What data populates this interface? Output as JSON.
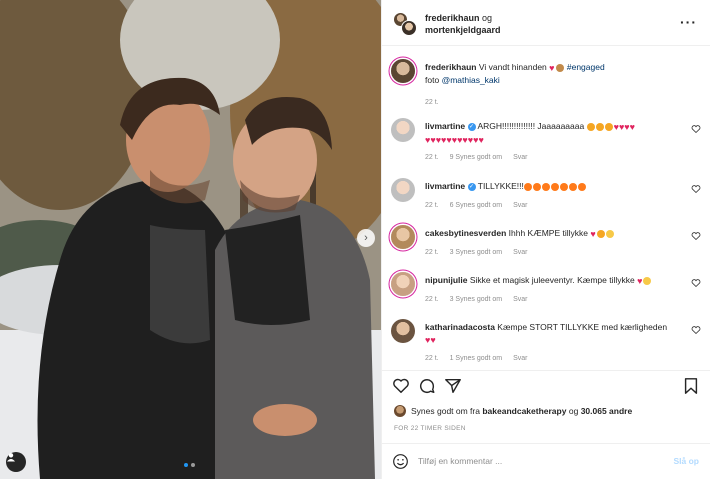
{
  "header": {
    "user1": "frederikhaun",
    "joiner": "og",
    "user2": "mortenkjeldgaard",
    "more_icon": "more-horizontal-icon"
  },
  "caption": {
    "username": "frederikhaun",
    "text": "Vi vandt hinanden",
    "hashtag": "#engaged",
    "photo_prefix": "foto",
    "mention": "@mathias_kaki",
    "time": "22 t."
  },
  "comments": [
    {
      "username": "livmartine",
      "verified": true,
      "text": "ARGH!!!!!!!!!!!!!! Jaaaaaaaaa",
      "time": "22 t.",
      "likes": "9 Synes godt om",
      "reply": "Svar",
      "emojis": [
        "fire-face",
        "fire-face",
        "fire-face",
        "heart",
        "heart",
        "heart",
        "heart",
        "heart",
        "heart",
        "heart",
        "heart",
        "heart",
        "heart",
        "heart",
        "heart"
      ]
    },
    {
      "username": "livmartine",
      "verified": true,
      "text": "TILLYKKE!!!",
      "time": "22 t.",
      "likes": "6 Synes godt om",
      "reply": "Svar",
      "emojis": [
        "fire",
        "fire",
        "fire",
        "fire",
        "fire",
        "fire",
        "fire"
      ]
    },
    {
      "username": "cakesbytinesverden",
      "verified": false,
      "text": "Ihhh KÆMPE tillykke",
      "time": "22 t.",
      "likes": "3 Synes godt om",
      "reply": "Svar",
      "emojis": [
        "heart",
        "fire-face",
        "clap"
      ]
    },
    {
      "username": "nipunijulie",
      "verified": false,
      "text": "Sikke et magisk juleeventyr. Kæmpe tillykke",
      "time": "22 t.",
      "likes": "3 Synes godt om",
      "reply": "Svar",
      "emojis": [
        "heart",
        "sparkle"
      ]
    },
    {
      "username": "katharinadacosta",
      "verified": false,
      "text": "Kæmpe STORT TILLYKKE med kærligheden",
      "time": "22 t.",
      "likes": "1 Synes godt om",
      "reply": "Svar",
      "emojis": [
        "heart",
        "heart"
      ]
    }
  ],
  "actions": {
    "like_icon": "heart-outline-icon",
    "comment_icon": "comment-bubble-icon",
    "share_icon": "paper-plane-icon",
    "save_icon": "bookmark-icon"
  },
  "likes": {
    "prefix": "Synes godt om fra",
    "user": "bakeandcaketherapy",
    "joiner": "og",
    "others": "30.065 andre"
  },
  "time_ago": "FOR 22 TIMER SIDEN",
  "add_comment": {
    "placeholder": "Tilføj en kommentar ...",
    "post_label": "Slå op"
  },
  "colors": {
    "accent": "#0095f6",
    "heart": "#e0245e",
    "verified": "#3897f0",
    "muted": "#8e8e8e",
    "post_disabled": "#b3dbff"
  }
}
